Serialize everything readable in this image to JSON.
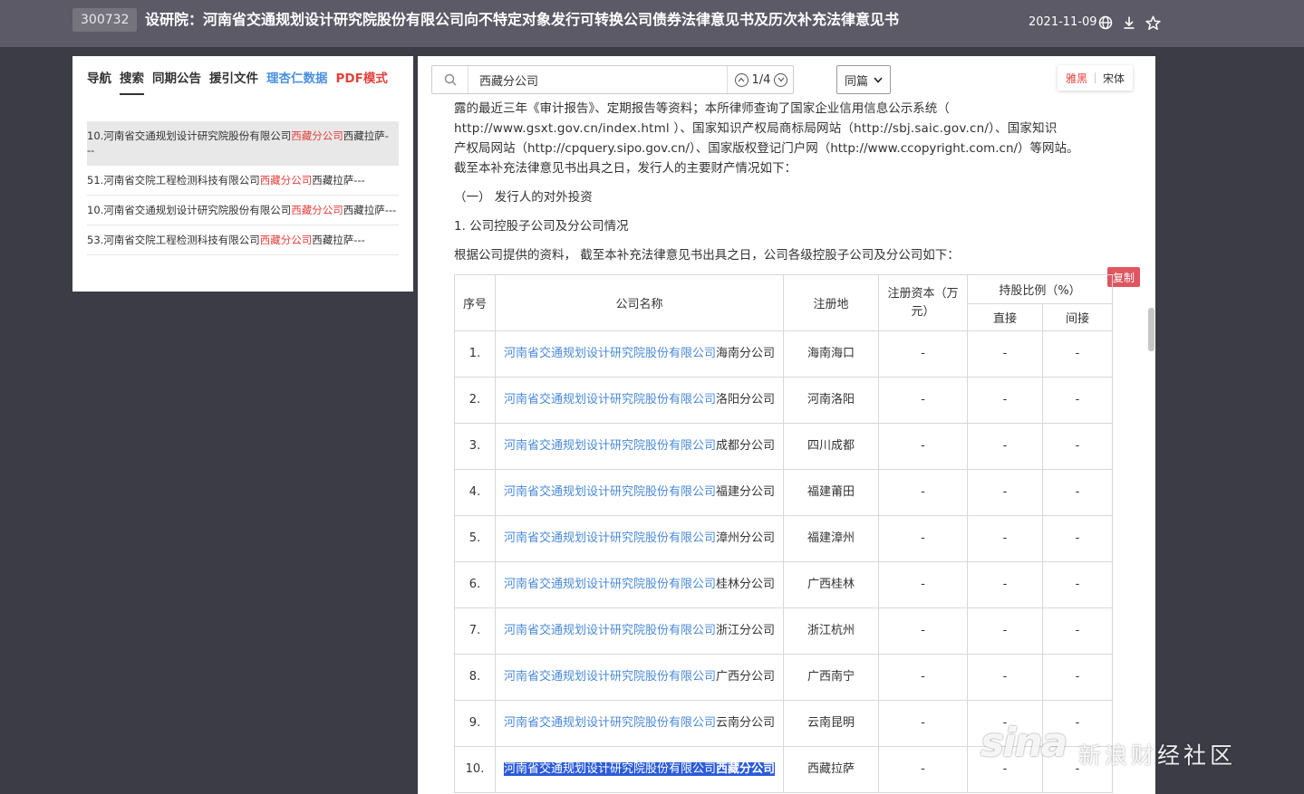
{
  "header": {
    "stock_code": "300732",
    "title": "设研院：河南省交通规划设计研究院股份有限公司向不特定对象发行可转换公司债券法律意见书及历次补充法律意见书",
    "date": "2021-11-09",
    "icons": [
      "globe-icon",
      "download-icon",
      "star-icon"
    ]
  },
  "left_panel": {
    "tabs": [
      "导航",
      "搜索",
      "同期公告",
      "援引文件",
      "理杏仁数据",
      "PDF模式"
    ],
    "active_tab": "搜索",
    "results": [
      {
        "prefix": "10.河南省交通规划设计研究院股份有限公司",
        "highlight": "西藏分公司",
        "suffix": "西藏拉萨---"
      },
      {
        "prefix": "51.河南省交院工程检测科技有限公司",
        "highlight": "西藏分公司",
        "suffix": "西藏拉萨---"
      },
      {
        "prefix": "10.河南省交通规划设计研究院股份有限公司",
        "highlight": "西藏分公司",
        "suffix": "西藏拉萨---"
      },
      {
        "prefix": "53.河南省交院工程检测科技有限公司",
        "highlight": "西藏分公司",
        "suffix": "西藏拉萨---"
      }
    ]
  },
  "search": {
    "value": "西藏分公司",
    "counter": "1/4",
    "scope": "同篇"
  },
  "font_switch": {
    "option1": "雅黑",
    "option2": "宋体"
  },
  "document": {
    "paragraph_lines": [
      "露的最近三年《审计报告》、定期报告等资料；本所律师查询了国家企业信用信息公示系统（",
      "http://www.gsxt.gov.cn/index.html ）、国家知识产权局商标局网站（http://sbj.saic.gov.cn/）、国家知识",
      "产权局网站（http://cpquery.sipo.gov.cn/）、国家版权登记门户网（http://www.ccopyright.com.cn/）等网站。",
      "截至本补充法律意见书出具之日，发行人的主要财产情况如下："
    ],
    "section_heading": "（一）  发行人的对外投资",
    "sub_heading": "1. 公司控股子公司及分公司情况",
    "intro": "根据公司提供的资料， 截至本补充法律意见书出具之日，公司各级控股子公司及分公司如下：",
    "copy_label": "复制"
  },
  "table": {
    "headers": {
      "no": "序号",
      "name": "公司名称",
      "place": "注册地",
      "capital": "注册资本（万元）",
      "ratio": "持股比例（%）",
      "direct": "直接",
      "indirect": "间接"
    },
    "rows": [
      {
        "no": "1.",
        "link": "河南省交通规划设计研究院股份有限公司",
        "rest": "海南分公司",
        "place": "海南海口",
        "capital": "-",
        "direct": "-",
        "indirect": "-"
      },
      {
        "no": "2.",
        "link": "河南省交通规划设计研究院股份有限公司",
        "rest": "洛阳分公司",
        "place": "河南洛阳",
        "capital": "-",
        "direct": "-",
        "indirect": "-"
      },
      {
        "no": "3.",
        "link": "河南省交通规划设计研究院股份有限公司",
        "rest": "成都分公司",
        "place": "四川成都",
        "capital": "-",
        "direct": "-",
        "indirect": "-"
      },
      {
        "no": "4.",
        "link": "河南省交通规划设计研究院股份有限公司",
        "rest": "福建分公司",
        "place": "福建莆田",
        "capital": "-",
        "direct": "-",
        "indirect": "-"
      },
      {
        "no": "5.",
        "link": "河南省交通规划设计研究院股份有限公司",
        "rest": "漳州分公司",
        "place": "福建漳州",
        "capital": "-",
        "direct": "-",
        "indirect": "-"
      },
      {
        "no": "6.",
        "link": "河南省交通规划设计研究院股份有限公司",
        "rest": "桂林分公司",
        "place": "广西桂林",
        "capital": "-",
        "direct": "-",
        "indirect": "-"
      },
      {
        "no": "7.",
        "link": "河南省交通规划设计研究院股份有限公司",
        "rest": "浙江分公司",
        "place": "浙江杭州",
        "capital": "-",
        "direct": "-",
        "indirect": "-"
      },
      {
        "no": "8.",
        "link": "河南省交通规划设计研究院股份有限公司",
        "rest": "广西分公司",
        "place": "广西南宁",
        "capital": "-",
        "direct": "-",
        "indirect": "-"
      },
      {
        "no": "9.",
        "link": "河南省交通规划设计研究院股份有限公司",
        "rest": "云南分公司",
        "place": "云南昆明",
        "capital": "-",
        "direct": "-",
        "indirect": "-"
      },
      {
        "no": "10.",
        "link": "河南省交通规划设计研究院股份有限公司",
        "rest": "西藏分公司",
        "place": "西藏拉萨",
        "capital": "-",
        "direct": "-",
        "indirect": "-",
        "selected": true
      }
    ]
  },
  "watermark": {
    "logo": "sina",
    "text": "新浪财经社区"
  }
}
